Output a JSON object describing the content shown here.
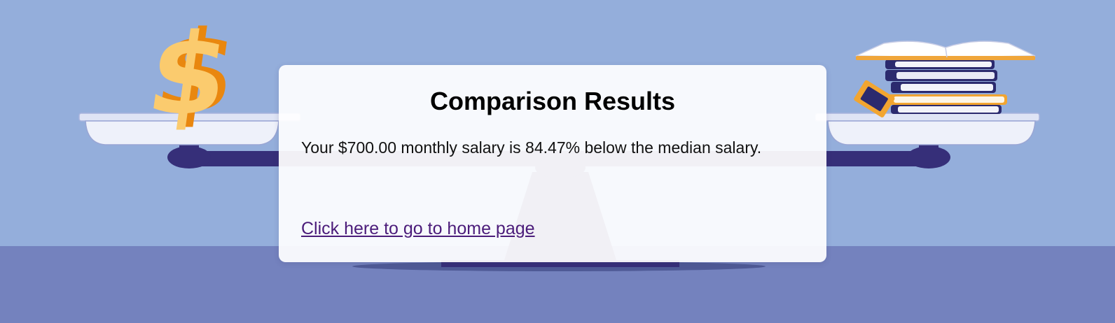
{
  "result": {
    "title": "Comparison Results",
    "message": "Your $700.00 monthly salary is 84.47% below the median salary.",
    "home_link": "Click here to go to home page"
  },
  "illustration": {
    "left_pan_object": "dollar-sign-icon",
    "right_pan_object": "stack-of-books-icon",
    "scale": "balance-scale"
  },
  "colors": {
    "sky": "#94aedb",
    "floor": "#7482be",
    "scale_dark": "#362f79",
    "dollar_gold": "#fbcb6e",
    "dollar_orange": "#e9870f",
    "link": "#4b1c7a"
  }
}
